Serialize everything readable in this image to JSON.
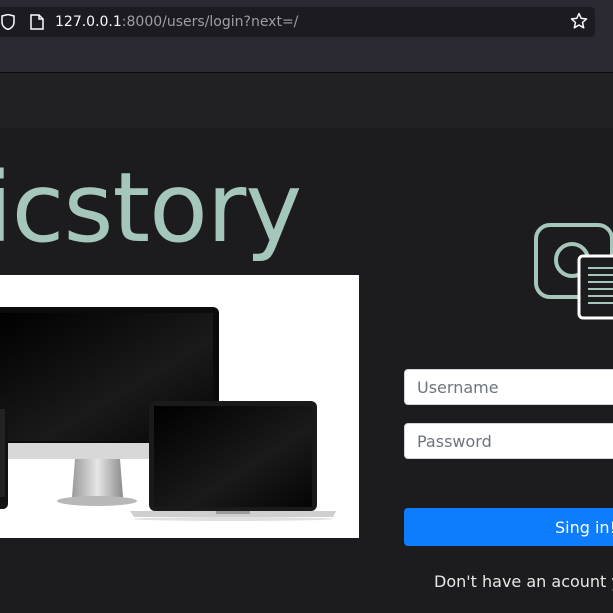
{
  "browser": {
    "url_host": "127.0.0.1",
    "url_path": ":8000/users/login?next=/",
    "icons": [
      "shield-icon",
      "page-icon",
      "star-icon"
    ]
  },
  "brand": {
    "title": "icstory",
    "color": "#a5c6ba",
    "logo_icon": "camera-document-icon"
  },
  "login": {
    "username_placeholder": "Username",
    "password_placeholder": "Password",
    "submit_label": "Sing in!",
    "signup_text": "Don't have an acount ye"
  },
  "colors": {
    "page_bg": "#1c1b1d",
    "button": "#0d7dfd",
    "accent": "#a5c6ba"
  }
}
